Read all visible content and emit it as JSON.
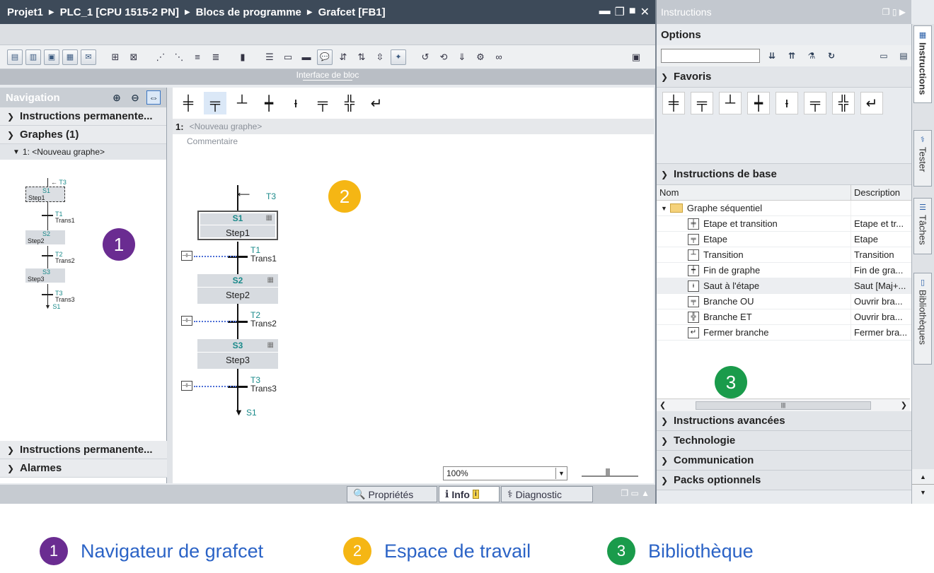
{
  "breadcrumb": {
    "items": [
      "Projet1",
      "PLC_1 [CPU 1515-2 PN]",
      "Blocs de programme",
      "Grafcet [FB1]"
    ]
  },
  "window_controls": [
    "▬",
    "❐",
    "■",
    "✕"
  ],
  "interface_bar": {
    "label": "Interface de bloc"
  },
  "navigation": {
    "title": "Navigation",
    "sections_top": [
      {
        "label": "Instructions permanente...",
        "expanded": false
      },
      {
        "label": "Graphes (1)",
        "expanded": true
      }
    ],
    "graph_item": "1: <Nouveau graphe>",
    "mini_graph": {
      "top_jump": "T3",
      "steps": [
        {
          "num": "S1",
          "name": "Step1"
        },
        {
          "num": "S2",
          "name": "Step2"
        },
        {
          "num": "S3",
          "name": "Step3"
        }
      ],
      "transitions": [
        {
          "num": "T1",
          "name": "Trans1"
        },
        {
          "num": "T2",
          "name": "Trans2"
        },
        {
          "num": "T3",
          "name": "Trans3"
        }
      ],
      "end_jump": "S1"
    },
    "sections_bottom": [
      {
        "label": "Instructions permanente...",
        "expanded": false
      },
      {
        "label": "Alarmes",
        "expanded": false
      }
    ]
  },
  "workspace": {
    "network_number": "1:",
    "network_title": "<Nouveau graphe>",
    "comment": "Commentaire",
    "graph": {
      "top_jump": "T3",
      "steps": [
        {
          "num": "S1",
          "name": "Step1"
        },
        {
          "num": "S2",
          "name": "Step2"
        },
        {
          "num": "S3",
          "name": "Step3"
        }
      ],
      "transitions": [
        {
          "num": "T1",
          "name": "Trans1"
        },
        {
          "num": "T2",
          "name": "Trans2"
        },
        {
          "num": "T3",
          "name": "Trans3"
        }
      ],
      "end_jump": "S1"
    },
    "zoom_value": "100%"
  },
  "status_tabs": [
    {
      "label": "Propriétés",
      "icon": "properties-icon"
    },
    {
      "label": "Info",
      "icon": "info-icon"
    },
    {
      "label": "Diagnostic",
      "icon": "diagnostic-icon"
    }
  ],
  "right_panel": {
    "title": "Instructions",
    "options_label": "Options",
    "favorites_label": "Favoris",
    "basic_label": "Instructions de base",
    "col_name": "Nom",
    "col_desc": "Description",
    "folder": "Graphe séquentiel",
    "rows": [
      {
        "name": "Etape et transition",
        "desc": "Etape et tr..."
      },
      {
        "name": "Etape",
        "desc": "Etape"
      },
      {
        "name": "Transition",
        "desc": "Transition"
      },
      {
        "name": "Fin de graphe",
        "desc": "Fin de gra..."
      },
      {
        "name": "Saut à l'étape",
        "desc": "Saut [Maj+..."
      },
      {
        "name": "Branche OU",
        "desc": "Ouvrir bra..."
      },
      {
        "name": "Branche ET",
        "desc": "Ouvrir bra..."
      },
      {
        "name": "Fermer branche",
        "desc": "Fermer bra..."
      }
    ],
    "collapsed_sections": [
      "Instructions avancées",
      "Technologie",
      "Communication",
      "Packs optionnels"
    ]
  },
  "side_tabs": [
    "Instructions",
    "Tester",
    "Tâches",
    "Bibliothèques"
  ],
  "badges": {
    "one": "1",
    "two": "2",
    "three": "3"
  },
  "legend": [
    {
      "num": "1",
      "label": "Navigateur de grafcet",
      "color": "#6a2c91"
    },
    {
      "num": "2",
      "label": "Espace de travail",
      "color": "#f5b614"
    },
    {
      "num": "3",
      "label": "Bibliothèque",
      "color": "#1a9b4b"
    }
  ],
  "colors": {
    "title_bar": "#3d4a59",
    "step_label": "#1a8a8a",
    "legend_text": "#2b63c6"
  }
}
